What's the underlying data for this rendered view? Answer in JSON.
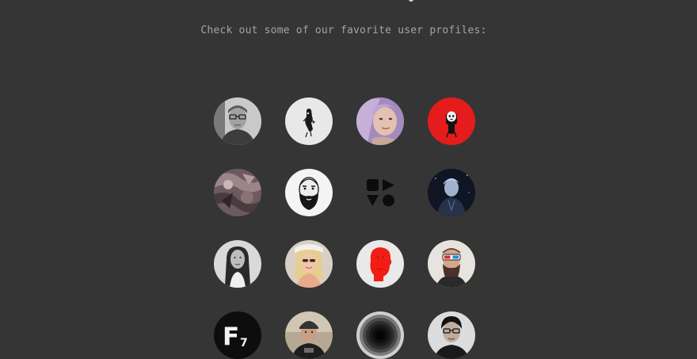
{
  "page": {
    "subtitle": "Check out some of our favorite user profiles:"
  },
  "profiles": [
    {
      "icon": "avatar-man-glasses-bw"
    },
    {
      "icon": "avatar-ink-figure-bw"
    },
    {
      "icon": "avatar-woman-purple-hair"
    },
    {
      "icon": "avatar-red-skull-character"
    },
    {
      "icon": "avatar-abstract-pattern"
    },
    {
      "icon": "avatar-bearded-man-sketch"
    },
    {
      "icon": "avatar-geometric-shapes"
    },
    {
      "icon": "avatar-man-dark-night"
    },
    {
      "icon": "avatar-woman-long-hair-bw"
    },
    {
      "icon": "avatar-blonde-woman-selfie"
    },
    {
      "icon": "avatar-red-head-silhouette"
    },
    {
      "icon": "avatar-man-3d-glasses"
    },
    {
      "icon": "avatar-f7-logo"
    },
    {
      "icon": "avatar-man-beanie"
    },
    {
      "icon": "avatar-concentric-rings"
    },
    {
      "icon": "avatar-man-glasses-dark-hair"
    }
  ]
}
